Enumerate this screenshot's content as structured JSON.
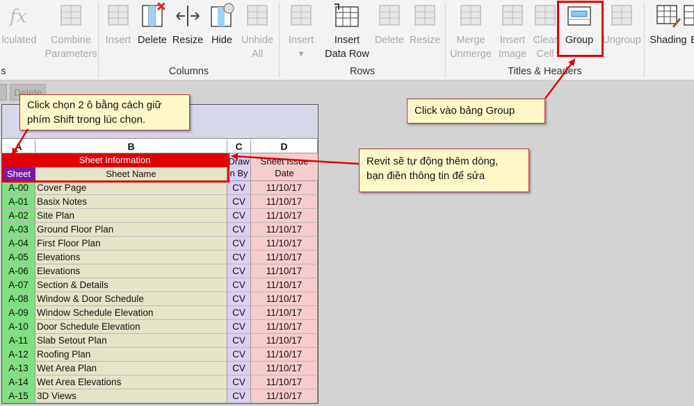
{
  "ribbon": {
    "buttons": [
      {
        "id": "calculated",
        "label": "lculated",
        "label2": "",
        "disabled": true,
        "icon": "fx-icon"
      },
      {
        "id": "combine",
        "label": "Combine",
        "label2": "Parameters",
        "disabled": true,
        "icon": "combine-parameters-icon"
      },
      {
        "id": "insert-col",
        "label": "Insert",
        "label2": "",
        "disabled": true,
        "icon": "insert-column-icon"
      },
      {
        "id": "delete-col",
        "label": "Delete",
        "label2": "",
        "disabled": false,
        "icon": "delete-column-icon"
      },
      {
        "id": "resize-col",
        "label": "Resize",
        "label2": "",
        "disabled": false,
        "icon": "resize-column-icon"
      },
      {
        "id": "hide-col",
        "label": "Hide",
        "label2": "",
        "disabled": false,
        "icon": "hide-column-icon"
      },
      {
        "id": "unhide-col",
        "label": "Unhide",
        "label2": "All",
        "disabled": true,
        "icon": "unhide-all-icon"
      },
      {
        "id": "insert-row",
        "label": "Insert",
        "label2": "▾",
        "disabled": true,
        "icon": "insert-row-icon"
      },
      {
        "id": "insert-data-row",
        "label": "Insert",
        "label2": "Data Row",
        "disabled": false,
        "icon": "insert-data-row-icon"
      },
      {
        "id": "delete-row",
        "label": "Delete",
        "label2": "",
        "disabled": true,
        "icon": "delete-row-icon"
      },
      {
        "id": "resize-row",
        "label": "Resize",
        "label2": "",
        "disabled": true,
        "icon": "resize-row-icon"
      },
      {
        "id": "merge",
        "label": "Merge",
        "label2": "Unmerge",
        "disabled": true,
        "icon": "merge-unmerge-icon"
      },
      {
        "id": "insert-image",
        "label": "Insert",
        "label2": "Image",
        "disabled": true,
        "icon": "insert-image-icon"
      },
      {
        "id": "clear-cell",
        "label": "Clear",
        "label2": "Cell",
        "disabled": true,
        "icon": "clear-cell-icon"
      },
      {
        "id": "group",
        "label": "Group",
        "label2": "",
        "disabled": false,
        "icon": "group-icon"
      },
      {
        "id": "ungroup",
        "label": "Ungroup",
        "label2": "",
        "disabled": true,
        "icon": "ungroup-icon"
      },
      {
        "id": "shading",
        "label": "Shading",
        "label2": "",
        "disabled": false,
        "icon": "shading-icon"
      },
      {
        "id": "borders",
        "label": "B",
        "label2": "",
        "disabled": false,
        "icon": "borders-icon"
      }
    ],
    "panels": {
      "parameters": "s",
      "columns": "Columns",
      "rows": "Rows",
      "titles": "Titles & Headers"
    }
  },
  "subbar": {
    "delete_label": "Delete"
  },
  "schedule": {
    "columns": [
      "A",
      "B",
      "C",
      "D"
    ],
    "group_header": "Sheet Information",
    "headers": {
      "a": "Sheet",
      "b": "Sheet Name",
      "c": "Draw\nn By",
      "d": "Sheet Issue\nDate",
      "c_line1": "Draw",
      "c_line2": "n By",
      "d_line1": "Sheet Issue",
      "d_line2": "Date"
    },
    "rows": [
      {
        "num": "A-00",
        "name": "Cover Page",
        "by": "CV",
        "date": "11/10/17"
      },
      {
        "num": "A-01",
        "name": "Basix Notes",
        "by": "CV",
        "date": "11/10/17"
      },
      {
        "num": "A-02",
        "name": "Site Plan",
        "by": "CV",
        "date": "11/10/17"
      },
      {
        "num": "A-03",
        "name": "Ground Floor Plan",
        "by": "CV",
        "date": "11/10/17"
      },
      {
        "num": "A-04",
        "name": "First Floor Plan",
        "by": "CV",
        "date": "11/10/17"
      },
      {
        "num": "A-05",
        "name": "Elevations",
        "by": "CV",
        "date": "11/10/17"
      },
      {
        "num": "A-06",
        "name": "Elevations",
        "by": "CV",
        "date": "11/10/17"
      },
      {
        "num": "A-07",
        "name": "Section & Details",
        "by": "CV",
        "date": "11/10/17"
      },
      {
        "num": "A-08",
        "name": "Window & Door Schedule",
        "by": "CV",
        "date": "11/10/17"
      },
      {
        "num": "A-09",
        "name": "Window Schedule Elevation",
        "by": "CV",
        "date": "11/10/17"
      },
      {
        "num": "A-10",
        "name": "Door Schedule Elevation",
        "by": "CV",
        "date": "11/10/17"
      },
      {
        "num": "A-11",
        "name": "Slab Setout Plan",
        "by": "CV",
        "date": "11/10/17"
      },
      {
        "num": "A-12",
        "name": "Roofing Plan",
        "by": "CV",
        "date": "11/10/17"
      },
      {
        "num": "A-13",
        "name": "Wet Area Plan",
        "by": "CV",
        "date": "11/10/17"
      },
      {
        "num": "A-14",
        "name": "Wet Area Elevations",
        "by": "CV",
        "date": "11/10/17"
      },
      {
        "num": "A-15",
        "name": "3D Views",
        "by": "CV",
        "date": "11/10/17"
      }
    ]
  },
  "callouts": {
    "shift_select_line1": "Click chọn 2 ô bằng cách giữ",
    "shift_select_line2": "phím Shift trong lúc chọn.",
    "group": "Click vào bảng Group",
    "auto_row_line1": "Revit sẽ tự động thêm dòng,",
    "auto_row_line2": "bạn điền thông tin để sửa"
  },
  "colors": {
    "highlight": "#e00000",
    "sheet_col": "#7fe07f",
    "name_col": "#e4e4c8",
    "by_col": "#dccff4",
    "date_col": "#f6cccc",
    "header_sheet": "#7a18a8",
    "callout_bg": "#fff9c8"
  }
}
